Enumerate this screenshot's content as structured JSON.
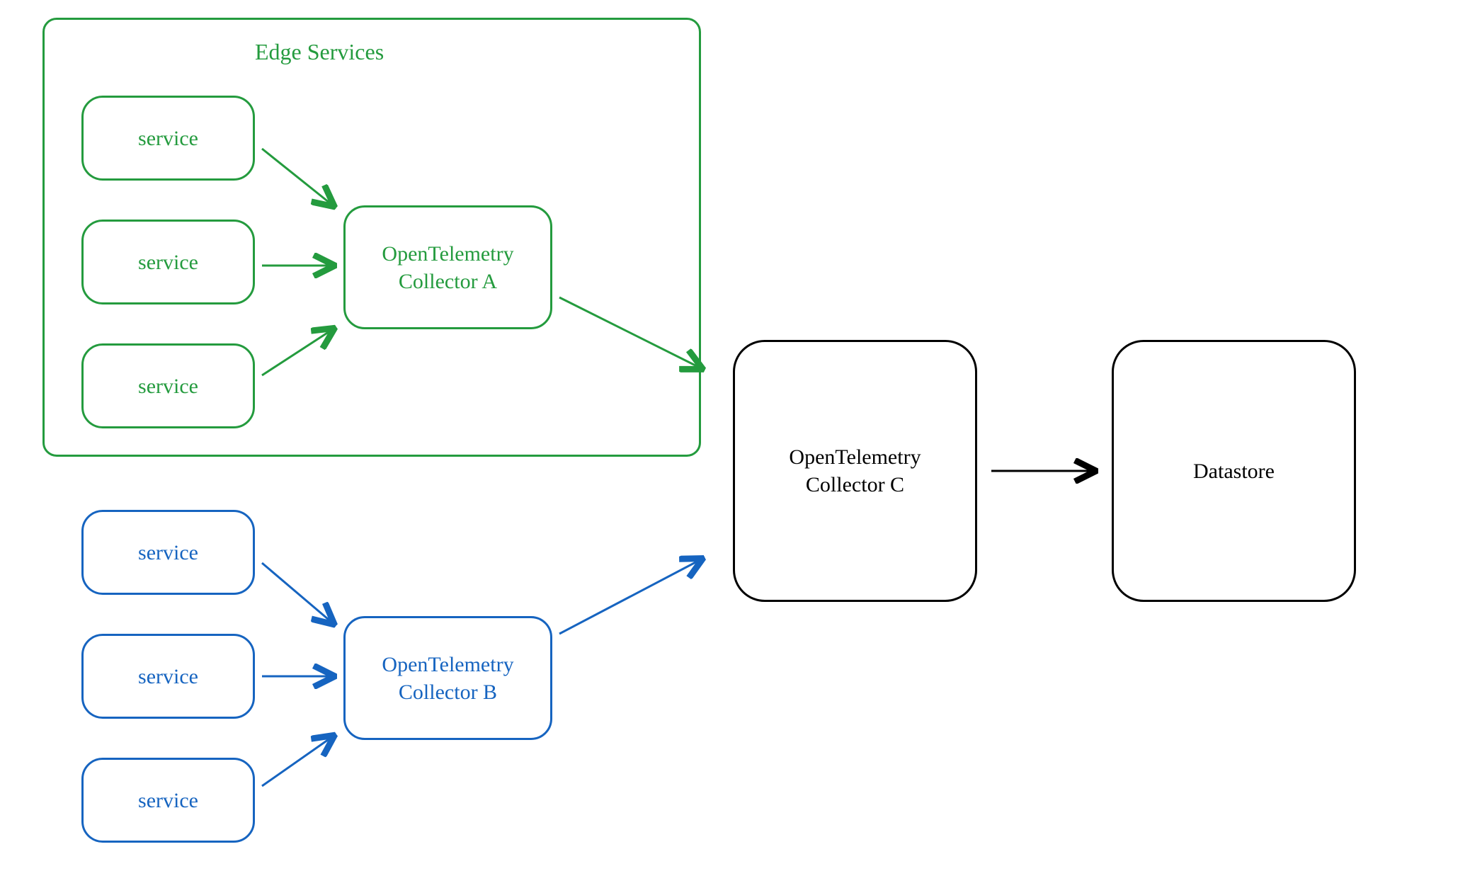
{
  "edgeServices": {
    "title": "Edge Services",
    "services": [
      "service",
      "service",
      "service"
    ],
    "collector": "OpenTelemetry\nCollector A"
  },
  "blueGroup": {
    "services": [
      "service",
      "service",
      "service"
    ],
    "collector": "OpenTelemetry\nCollector B"
  },
  "collectorC": "OpenTelemetry\nCollector C",
  "datastore": "Datastore",
  "colors": {
    "green": "#249B3E",
    "blue": "#1664C0",
    "black": "#000000"
  }
}
